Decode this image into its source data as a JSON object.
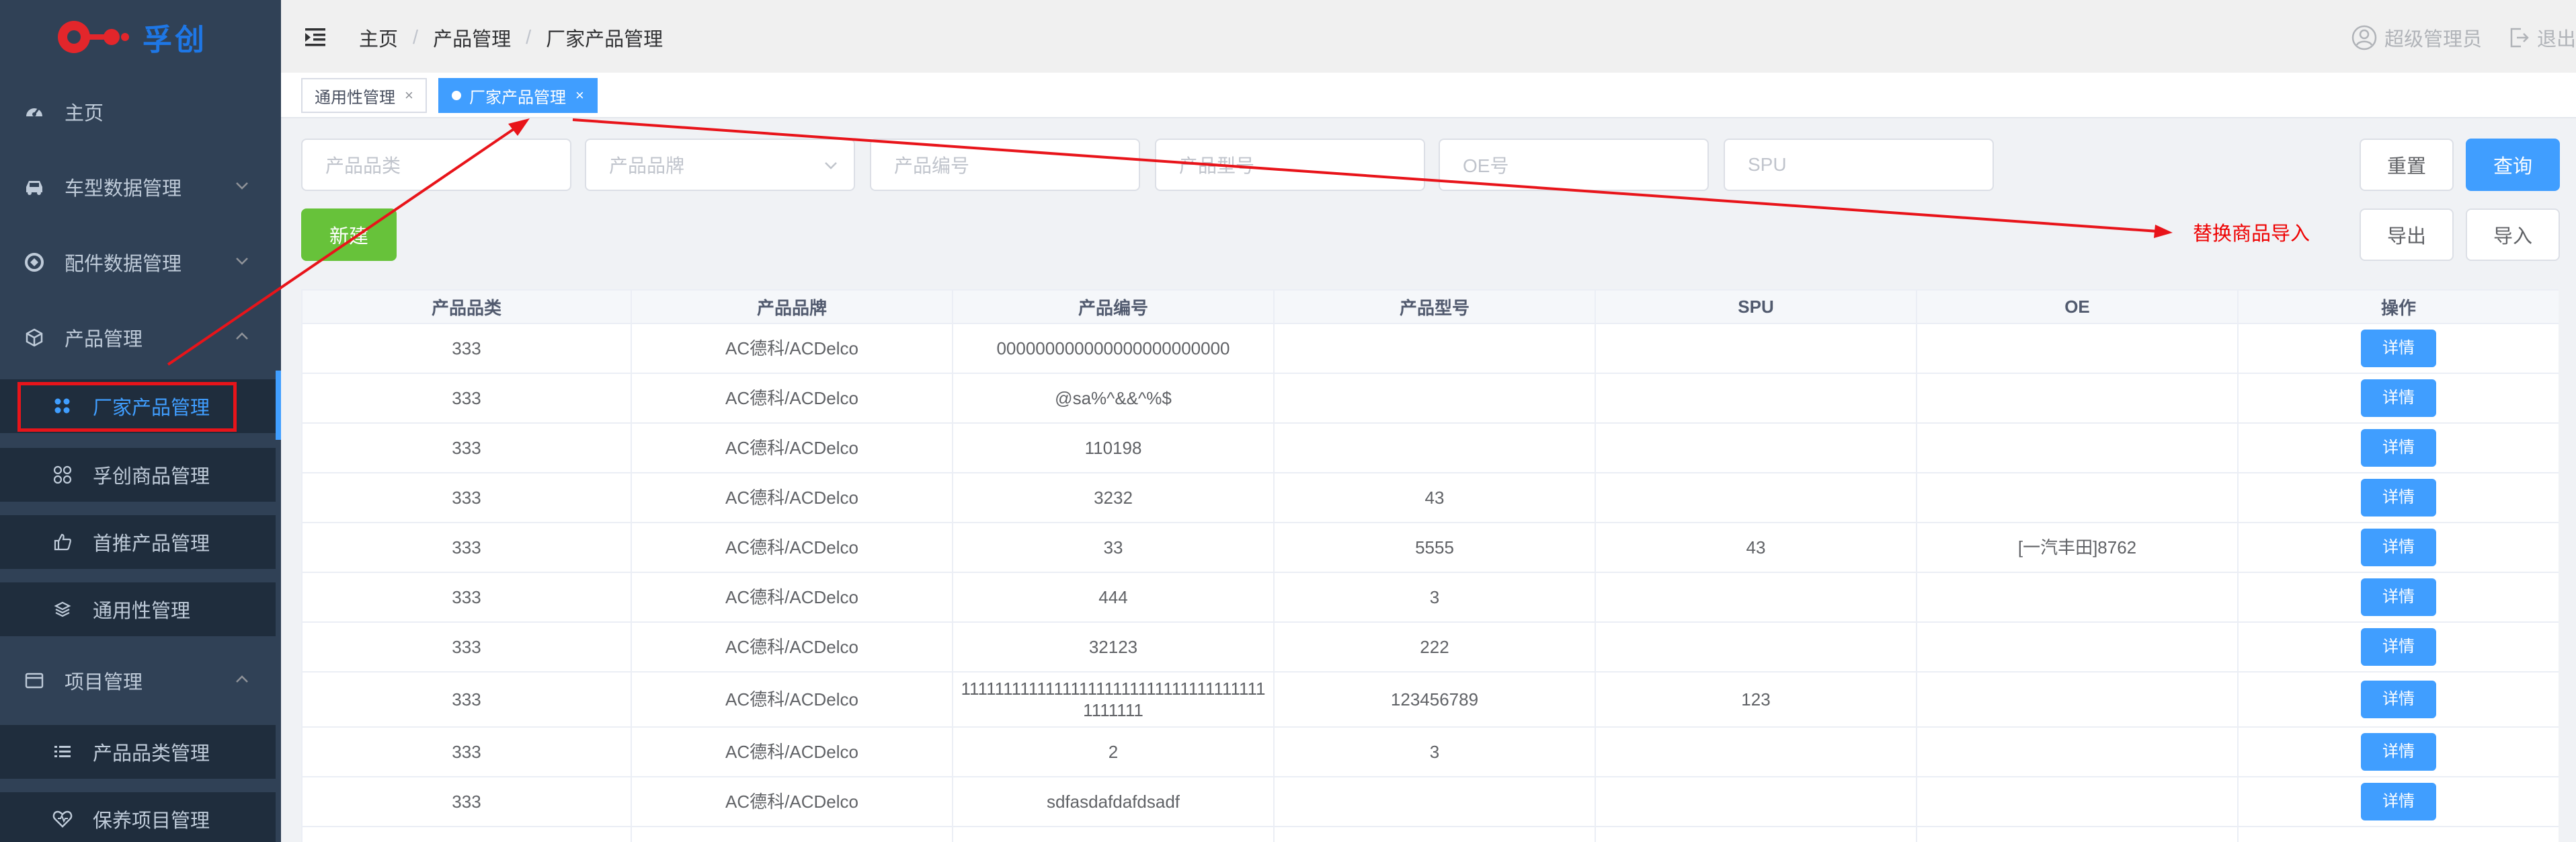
{
  "logo": {
    "text": "孚创"
  },
  "sidebar": {
    "items": [
      {
        "label": "主页",
        "icon": "dashboard-icon"
      },
      {
        "label": "车型数据管理",
        "icon": "car-icon"
      },
      {
        "label": "配件数据管理",
        "icon": "parts-icon"
      },
      {
        "label": "产品管理",
        "icon": "cube-icon"
      },
      {
        "label": "厂家产品管理",
        "icon": "grid-icon"
      },
      {
        "label": "孚创商品管理",
        "icon": "apps-icon"
      },
      {
        "label": "首推产品管理",
        "icon": "thumbs-up-icon"
      },
      {
        "label": "通用性管理",
        "icon": "layers-icon"
      },
      {
        "label": "项目管理",
        "icon": "folder-icon"
      },
      {
        "label": "产品品类管理",
        "icon": "list-icon"
      },
      {
        "label": "保养项目管理",
        "icon": "heart-icon"
      }
    ],
    "active": "厂家产品管理"
  },
  "header": {
    "breadcrumb": [
      "主页",
      "产品管理",
      "厂家产品管理"
    ],
    "separator": "/",
    "user": "超级管理员",
    "logout": "退出"
  },
  "tags": [
    {
      "label": "通用性管理",
      "close": "×"
    },
    {
      "label": "厂家产品管理",
      "close": "×"
    }
  ],
  "filters": {
    "category_placeholder": "产品品类",
    "brand_placeholder": "产品品牌",
    "code_placeholder": "产品编号",
    "model_placeholder": "产品型号",
    "oe_placeholder": "OE号",
    "spu_placeholder": "SPU"
  },
  "buttons": {
    "reset": "重置",
    "search": "查询",
    "new": "新建",
    "export": "导出",
    "import": "导入"
  },
  "annotation": {
    "note": "替换商品导入"
  },
  "table": {
    "columns": [
      "产品品类",
      "产品品牌",
      "产品编号",
      "产品型号",
      "SPU",
      "OE",
      "操作"
    ],
    "action_label": "详情",
    "rows": [
      [
        "333",
        "AC德科/ACDelco",
        "000000000000000000000000",
        "",
        "",
        ""
      ],
      [
        "333",
        "AC德科/ACDelco",
        "@sa%^&&^%$",
        "",
        "",
        ""
      ],
      [
        "333",
        "AC德科/ACDelco",
        "110198",
        "",
        "",
        ""
      ],
      [
        "333",
        "AC德科/ACDelco",
        "3232",
        "43",
        "",
        ""
      ],
      [
        "333",
        "AC德科/ACDelco",
        "33",
        "5555",
        "43",
        "[一汽丰田]8762"
      ],
      [
        "333",
        "AC德科/ACDelco",
        "444",
        "3",
        "",
        ""
      ],
      [
        "333",
        "AC德科/ACDelco",
        "32123",
        "222",
        "",
        ""
      ],
      [
        "333",
        "AC德科/ACDelco",
        "1111111111111111111111111111111111111111111",
        "123456789",
        "123",
        ""
      ],
      [
        "333",
        "AC德科/ACDelco",
        "2",
        "3",
        "",
        ""
      ],
      [
        "333",
        "AC德科/ACDelco",
        "sdfasdafdafdsadf",
        "",
        "",
        ""
      ],
      [
        "",
        "",
        "",
        "",
        "",
        ""
      ]
    ]
  },
  "colors": {
    "sidebar_bg": "#304156",
    "primary": "#409eff",
    "success": "#67c23a",
    "annotation_red": "#e8141a"
  }
}
